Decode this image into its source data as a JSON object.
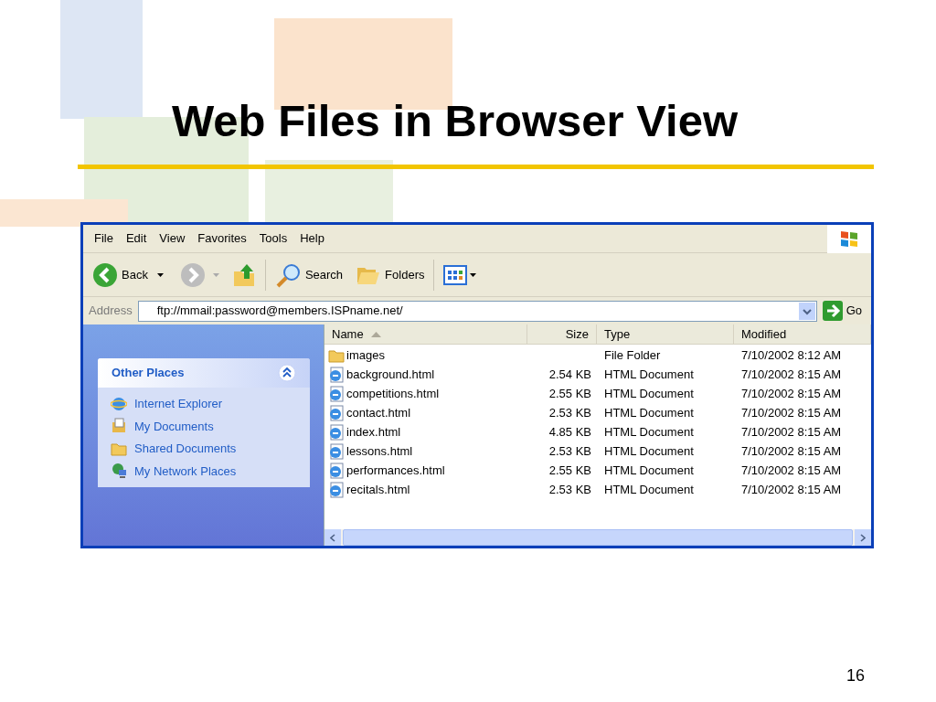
{
  "slide": {
    "title": "Web Files in Browser View",
    "page_number": "16"
  },
  "window": {
    "menu": [
      "File",
      "Edit",
      "View",
      "Favorites",
      "Tools",
      "Help"
    ],
    "toolbar": {
      "back": "Back",
      "search": "Search",
      "folders": "Folders"
    },
    "address": {
      "label": "Address",
      "value": "ftp://mmail:password@members.ISPname.net/",
      "go": "Go"
    },
    "task_pane": {
      "title": "Other Places",
      "expanded": true,
      "links": [
        {
          "label": "Internet Explorer",
          "kind": "browser"
        },
        {
          "label": "My Documents",
          "kind": "documents"
        },
        {
          "label": "Shared Documents",
          "kind": "folder"
        },
        {
          "label": "My Network Places",
          "kind": "network"
        }
      ]
    },
    "file_list": {
      "columns": [
        {
          "label": "Name",
          "sorted": true
        },
        {
          "label": "Size",
          "sorted": false
        },
        {
          "label": "Type",
          "sorted": false
        },
        {
          "label": "Modified",
          "sorted": false
        }
      ],
      "rows": [
        {
          "kind": "folder",
          "name": "images",
          "type": "File Folder",
          "modified": "7/10/2002 8:12 AM"
        },
        {
          "kind": "html",
          "name": "background.html",
          "size": "2.54 KB",
          "type": "HTML Document",
          "modified": "7/10/2002 8:15 AM"
        },
        {
          "kind": "html",
          "name": "competitions.html",
          "size": "2.55 KB",
          "type": "HTML Document",
          "modified": "7/10/2002 8:15 AM"
        },
        {
          "kind": "html",
          "name": "contact.html",
          "size": "2.53 KB",
          "type": "HTML Document",
          "modified": "7/10/2002 8:15 AM"
        },
        {
          "kind": "html",
          "name": "index.html",
          "size": "4.85 KB",
          "type": "HTML Document",
          "modified": "7/10/2002 8:15 AM"
        },
        {
          "kind": "html",
          "name": "lessons.html",
          "size": "2.53 KB",
          "type": "HTML Document",
          "modified": "7/10/2002 8:15 AM"
        },
        {
          "kind": "html",
          "name": "performances.html",
          "size": "2.55 KB",
          "type": "HTML Document",
          "modified": "7/10/2002 8:15 AM"
        },
        {
          "kind": "html",
          "name": "recitals.html",
          "size": "2.53 KB",
          "type": "HTML Document",
          "modified": "7/10/2002 8:15 AM"
        }
      ]
    }
  }
}
